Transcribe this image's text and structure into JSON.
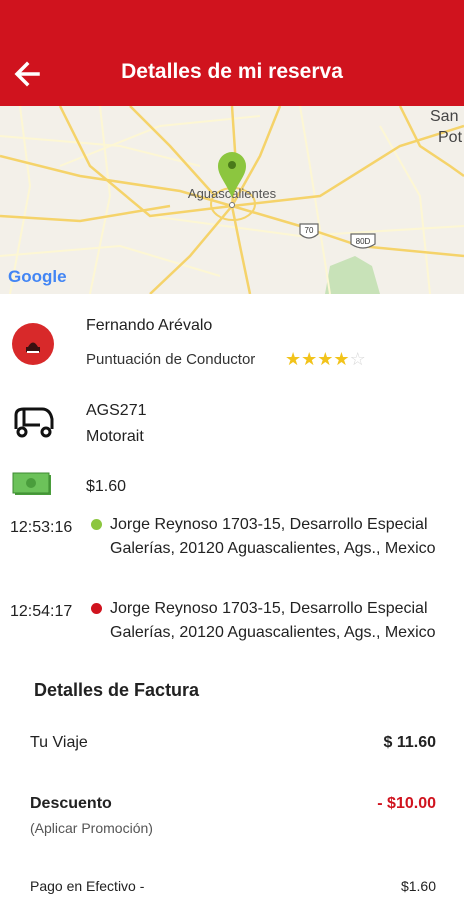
{
  "header": {
    "title": "Detalles de mi reserva"
  },
  "map": {
    "labels": [
      "Aguascalientes",
      "San",
      "Pot",
      "70",
      "80D"
    ],
    "watermark": "Google"
  },
  "driver": {
    "name": "Fernando Arévalo",
    "rating_label": "Puntuación de Conductor",
    "rating": 4,
    "rating_max": 5
  },
  "vehicle": {
    "plate": "AGS271",
    "model": "Motorait"
  },
  "fare": {
    "amount": "$1.60"
  },
  "stops": [
    {
      "time": "12:53:16",
      "status_color": "#8cc63f",
      "address": "Jorge Reynoso 1703-15, Desarrollo Especial Galerías, 20120 Aguascalientes, Ags., Mexico"
    },
    {
      "time": "12:54:17",
      "status_color": "#d0131e",
      "address": "Jorge Reynoso 1703-15, Desarrollo Especial Galerías, 20120 Aguascalientes, Ags., Mexico"
    }
  ],
  "invoice": {
    "title": "Detalles de Factura",
    "trip_label": "Tu Viaje",
    "trip_value": "$ 11.60",
    "discount_label": "Descuento",
    "discount_note": "(Aplicar Promoción)",
    "discount_value": "- $10.00",
    "cash_label": "Pago en Efectivo -",
    "cash_value": "$1.60"
  },
  "colors": {
    "primary": "#d0131e",
    "star": "#f2c31a",
    "discount": "#d0131e"
  }
}
